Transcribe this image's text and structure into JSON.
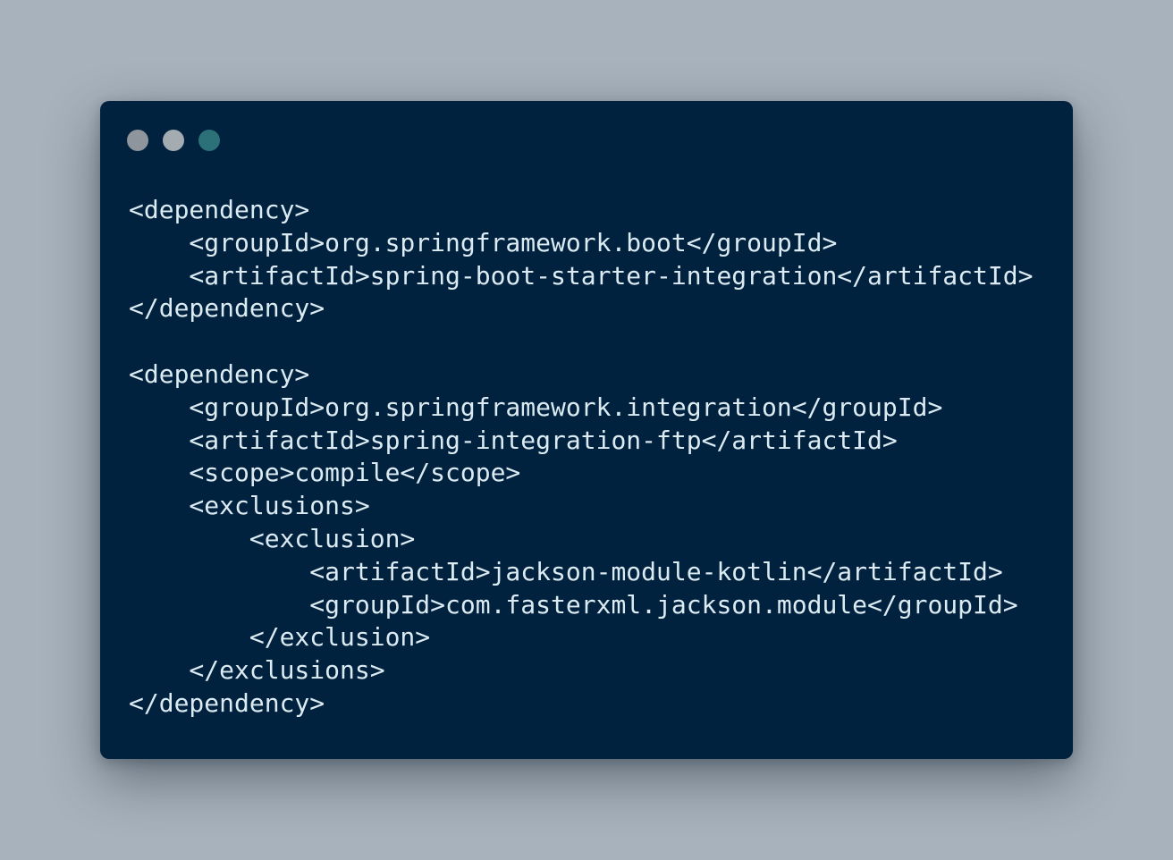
{
  "window": {
    "controls": [
      {
        "name": "close",
        "color": "#8e959c"
      },
      {
        "name": "minimize",
        "color": "#a4abb1"
      },
      {
        "name": "maximize",
        "color": "#2c7177"
      }
    ],
    "code_lines": [
      "<dependency>",
      "    <groupId>org.springframework.boot</groupId>",
      "    <artifactId>spring-boot-starter-integration</artifactId>",
      "</dependency>",
      "",
      "<dependency>",
      "    <groupId>org.springframework.integration</groupId>",
      "    <artifactId>spring-integration-ftp</artifactId>",
      "    <scope>compile</scope>",
      "    <exclusions>",
      "        <exclusion>",
      "            <artifactId>jackson-module-kotlin</artifactId>",
      "            <groupId>com.fasterxml.jackson.module</groupId>",
      "        </exclusion>",
      "    </exclusions>",
      "</dependency>"
    ]
  },
  "colors": {
    "background": "#a7b2bc",
    "window": "#00223f",
    "code_text": "#dcebf2"
  }
}
